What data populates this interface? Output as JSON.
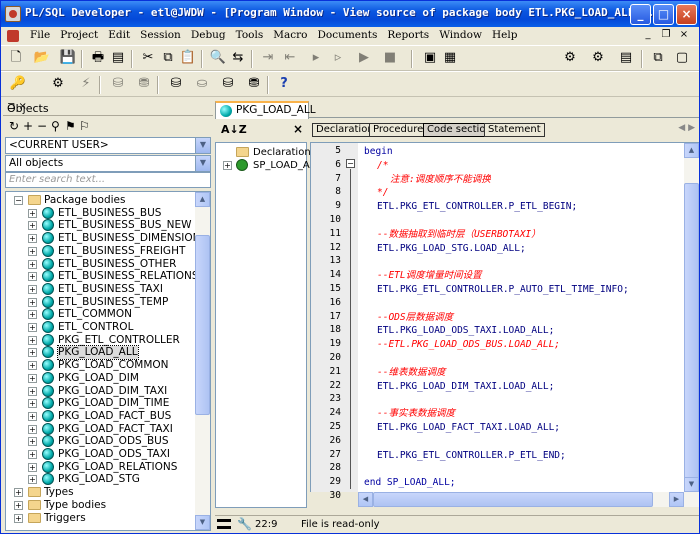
{
  "window": {
    "title": "PL/SQL Developer - etl@JWDW - [Program Window - View source of package body ETL.PKG_LOAD_ALL@J..."
  },
  "title_buttons": {
    "minimize": "_",
    "maximize": "□",
    "close": "×"
  },
  "menu": [
    "File",
    "Project",
    "Edit",
    "Session",
    "Debug",
    "Tools",
    "Macro",
    "Documents",
    "Reports",
    "Window",
    "Help"
  ],
  "toolbar1": [
    "new-icon",
    "open-icon",
    "save-icon",
    "print-icon",
    "print-preview-icon",
    "cut-icon",
    "copy-icon",
    "paste-icon",
    "find-icon",
    "replace-icon",
    "indent-icon",
    "unindent-icon",
    "window-icon",
    "window-list-icon",
    "tile-icon",
    "cascade-icon"
  ],
  "toolbar2": [
    "key-icon",
    "execute-icon",
    "break-icon",
    "commit-icon",
    "rollback-icon",
    "db-icon",
    "session-icon",
    "help-icon"
  ],
  "objects_panel": {
    "title": "Objects",
    "user_select": "<CURRENT USER>",
    "filter_select": "All objects",
    "filter_placeholder": "Enter search text..."
  },
  "tree": {
    "root": "Package bodies",
    "items": [
      "ETL_BUSINESS_BUS",
      "ETL_BUSINESS_BUS_NEW",
      "ETL_BUSINESS_DIMENSION",
      "ETL_BUSINESS_FREIGHT",
      "ETL_BUSINESS_OTHER",
      "ETL_BUSINESS_RELATIONS",
      "ETL_BUSINESS_TAXI",
      "ETL_BUSINESS_TEMP",
      "ETL_COMMON",
      "ETL_CONTROL",
      "PKG_ETL_CONTROLLER",
      "PKG_LOAD_ALL",
      "PKG_LOAD_COMMON",
      "PKG_LOAD_DIM",
      "PKG_LOAD_DIM_TAXI",
      "PKG_LOAD_DIM_TIME",
      "PKG_LOAD_FACT_BUS",
      "PKG_LOAD_FACT_TAXI",
      "PKG_LOAD_ODS_BUS",
      "PKG_LOAD_ODS_TAXI",
      "PKG_LOAD_RELATIONS",
      "PKG_LOAD_STG"
    ],
    "selected": "PKG_LOAD_ALL",
    "folders": [
      "Types",
      "Type bodies",
      "Triggers"
    ]
  },
  "tab": {
    "label": "PKG_LOAD_ALL"
  },
  "outline": {
    "sort_icon": "A↓Z",
    "items": [
      "Declaration",
      "SP_LOAD_ALL"
    ]
  },
  "sections": [
    "Declaration",
    "Procedure",
    "Code section",
    "Statement"
  ],
  "active_section": "Code section",
  "code": [
    {
      "n": "5",
      "text": "begin",
      "cls": "kw",
      "indent": 0
    },
    {
      "n": "6",
      "text": "/*",
      "cls": "cm",
      "indent": 2
    },
    {
      "n": "7",
      "text": "注意:调度顺序不能调换",
      "cls": "cm",
      "indent": 4
    },
    {
      "n": "8",
      "text": "*/",
      "cls": "cm",
      "indent": 2
    },
    {
      "n": "9",
      "text": "ETL.PKG_ETL_CONTROLLER.P_ETL_BEGIN;",
      "cls": "id",
      "indent": 2
    },
    {
      "n": "10",
      "text": "",
      "cls": "id",
      "indent": 2
    },
    {
      "n": "11",
      "text": "--数据抽取到临时层（USERBOTAXI）",
      "cls": "cm",
      "indent": 2
    },
    {
      "n": "12",
      "text": "ETL.PKG_LOAD_STG.LOAD_ALL;",
      "cls": "id",
      "indent": 2
    },
    {
      "n": "13",
      "text": "",
      "cls": "id",
      "indent": 2
    },
    {
      "n": "14",
      "text": "--ETL调度增量时间设置",
      "cls": "cm",
      "indent": 2
    },
    {
      "n": "15",
      "text": "ETL.PKG_ETL_CONTROLLER.P_AUTO_ETL_TIME_INFO;",
      "cls": "id",
      "indent": 2
    },
    {
      "n": "16",
      "text": "",
      "cls": "id",
      "indent": 2
    },
    {
      "n": "17",
      "text": "--ODS层数据调度",
      "cls": "cm",
      "indent": 2
    },
    {
      "n": "18",
      "text": "ETL.PKG_LOAD_ODS_TAXI.LOAD_ALL;",
      "cls": "id",
      "indent": 2
    },
    {
      "n": "19",
      "text": "--ETL.PKG_LOAD_ODS_BUS.LOAD_ALL;",
      "cls": "cm",
      "indent": 2
    },
    {
      "n": "20",
      "text": "",
      "cls": "id",
      "indent": 2
    },
    {
      "n": "21",
      "text": "--维表数据调度",
      "cls": "cm",
      "indent": 2
    },
    {
      "n": "22",
      "text": "ETL.PKG_LOAD_DIM_TAXI.LOAD_ALL;",
      "cls": "id",
      "indent": 2
    },
    {
      "n": "23",
      "text": "",
      "cls": "id",
      "indent": 2
    },
    {
      "n": "24",
      "text": "--事实表数据调度",
      "cls": "cm",
      "indent": 2
    },
    {
      "n": "25",
      "text": "ETL.PKG_LOAD_FACT_TAXI.LOAD_ALL;",
      "cls": "id",
      "indent": 2
    },
    {
      "n": "26",
      "text": "",
      "cls": "id",
      "indent": 2
    },
    {
      "n": "27",
      "text": "ETL.PKG_ETL_CONTROLLER.P_ETL_END;",
      "cls": "id",
      "indent": 2
    },
    {
      "n": "28",
      "text": "",
      "cls": "id",
      "indent": 0
    },
    {
      "n": "29",
      "text": "end SP_LOAD_ALL;",
      "cls": "kw",
      "indent": 0
    },
    {
      "n": "30",
      "text": "",
      "cls": "id",
      "indent": 0
    }
  ],
  "status": {
    "position": "22:9",
    "message": "File is read-only"
  }
}
